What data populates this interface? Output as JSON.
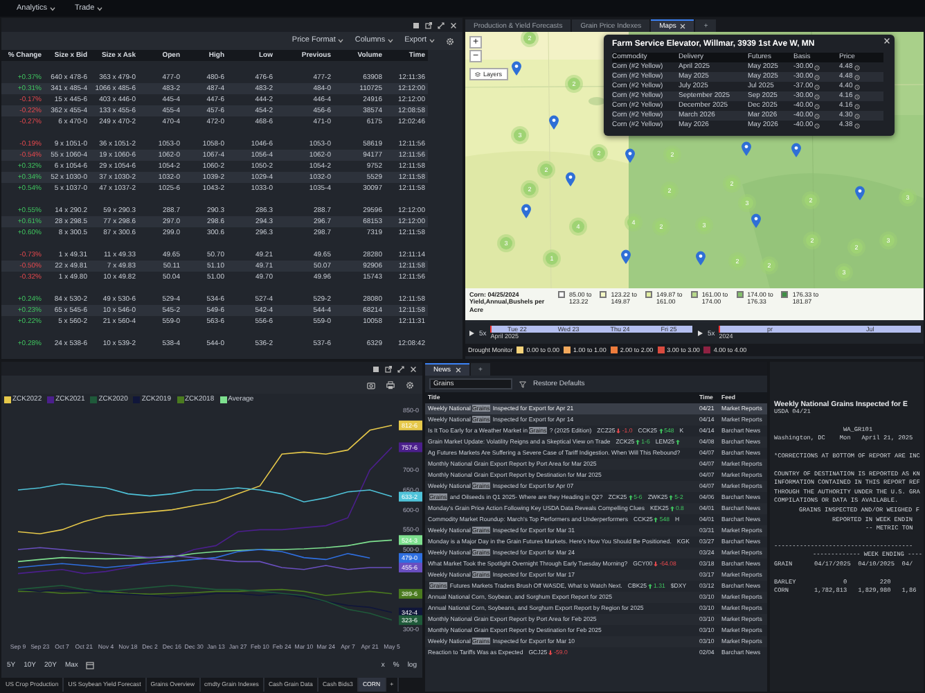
{
  "menu": [
    {
      "label": "Analytics"
    },
    {
      "label": "Trade"
    }
  ],
  "quotes": {
    "toolbar": [
      {
        "label": "Price Format"
      },
      {
        "label": "Columns"
      },
      {
        "label": "Export"
      }
    ],
    "columns": [
      "% Change",
      "Size x Bid",
      "Size x Ask",
      "Open",
      "High",
      "Low",
      "Previous",
      "Volume",
      "Time"
    ],
    "groups": [
      [
        {
          "rising": true,
          "cells": [
            "+0.37%",
            "640 x 478-6",
            "363 x 479-0",
            "477-0",
            "480-6",
            "476-6",
            "477-2",
            "63908",
            "12:11:36"
          ]
        },
        {
          "rising": true,
          "cells": [
            "+0.31%",
            "341 x 485-4",
            "1066 x 485-6",
            "483-2",
            "487-4",
            "483-2",
            "484-0",
            "110725",
            "12:12:00"
          ]
        },
        {
          "rising": false,
          "cells": [
            "-0.17%",
            "15 x 445-6",
            "403 x 446-0",
            "445-4",
            "447-6",
            "444-2",
            "446-4",
            "24916",
            "12:12:00"
          ]
        },
        {
          "rising": false,
          "cells": [
            "-0.22%",
            "362 x 455-4",
            "133 x 455-6",
            "455-4",
            "457-6",
            "454-2",
            "456-6",
            "38574",
            "12:08:58"
          ]
        },
        {
          "rising": false,
          "cells": [
            "-0.27%",
            "6 x 470-0",
            "249 x 470-2",
            "470-4",
            "472-0",
            "468-6",
            "471-0",
            "6175",
            "12:02:46"
          ]
        }
      ],
      [
        {
          "rising": false,
          "cells": [
            "-0.19%",
            "9 x 1051-0",
            "36 x 1051-2",
            "1053-0",
            "1058-0",
            "1046-6",
            "1053-0",
            "58619",
            "12:11:56"
          ]
        },
        {
          "rising": false,
          "cells": [
            "-0.54%",
            "55 x 1060-4",
            "19 x 1060-6",
            "1062-0",
            "1067-4",
            "1056-4",
            "1062-0",
            "94177",
            "12:11:56"
          ]
        },
        {
          "rising": true,
          "cells": [
            "+0.32%",
            "6 x 1054-6",
            "29 x 1054-6",
            "1054-2",
            "1060-2",
            "1050-2",
            "1054-2",
            "9752",
            "12:11:58"
          ]
        },
        {
          "rising": true,
          "cells": [
            "+0.34%",
            "52 x 1030-0",
            "37 x 1030-2",
            "1032-0",
            "1039-2",
            "1029-4",
            "1032-0",
            "5529",
            "12:11:58"
          ]
        },
        {
          "rising": true,
          "cells": [
            "+0.54%",
            "5 x 1037-0",
            "47 x 1037-2",
            "1025-6",
            "1043-2",
            "1033-0",
            "1035-4",
            "30097",
            "12:11:58"
          ]
        }
      ],
      [
        {
          "rising": true,
          "cells": [
            "+0.55%",
            "14 x 290.2",
            "59 x 290.3",
            "288.7",
            "290.3",
            "286.3",
            "288.7",
            "29596",
            "12:12:00"
          ]
        },
        {
          "rising": true,
          "cells": [
            "+0.61%",
            "28 x 298.5",
            "77 x 298.6",
            "297.0",
            "298.6",
            "294.3",
            "296.7",
            "68153",
            "12:12:00"
          ]
        },
        {
          "rising": true,
          "cells": [
            "+0.60%",
            "8 x 300.5",
            "87 x 300.6",
            "299.0",
            "300.6",
            "296.3",
            "298.7",
            "7319",
            "12:11:58"
          ]
        }
      ],
      [
        {
          "rising": false,
          "cells": [
            "-0.73%",
            "1 x 49.31",
            "11 x 49.33",
            "49.65",
            "50.70",
            "49.21",
            "49.65",
            "28280",
            "12:11:14"
          ]
        },
        {
          "rising": false,
          "cells": [
            "-0.50%",
            "22 x 49.81",
            "7 x 49.83",
            "50.11",
            "51.10",
            "49.71",
            "50.07",
            "92906",
            "12:11:58"
          ]
        },
        {
          "rising": false,
          "cells": [
            "-0.32%",
            "1 x 49.80",
            "10 x 49.82",
            "50.04",
            "51.00",
            "49.70",
            "49.96",
            "15743",
            "12:11:56"
          ]
        }
      ],
      [
        {
          "rising": true,
          "cells": [
            "+0.24%",
            "84 x 530-2",
            "49 x 530-6",
            "529-4",
            "534-6",
            "527-4",
            "529-2",
            "28080",
            "12:11:58"
          ]
        },
        {
          "rising": true,
          "cells": [
            "+0.23%",
            "65 x 545-6",
            "10 x 546-0",
            "545-2",
            "549-6",
            "542-4",
            "544-4",
            "68214",
            "12:11:58"
          ]
        },
        {
          "rising": true,
          "cells": [
            "+0.22%",
            "5 x 560-2",
            "21 x 560-4",
            "559-0",
            "563-6",
            "556-6",
            "559-0",
            "10058",
            "12:11:31"
          ]
        }
      ],
      [
        {
          "rising": true,
          "cells": [
            "+0.28%",
            "24 x 538-6",
            "10 x 539-2",
            "538-4",
            "544-0",
            "536-2",
            "537-6",
            "6329",
            "12:08:42"
          ]
        }
      ]
    ]
  },
  "map": {
    "tabs": [
      {
        "label": "Production & Yield Forecasts",
        "selected": false,
        "closable": false
      },
      {
        "label": "Grain Price Indexes",
        "selected": false,
        "closable": false
      },
      {
        "label": "Maps",
        "selected": true,
        "closable": true
      }
    ],
    "add": "+",
    "zoom_in": "+",
    "zoom_out": "−",
    "layers": "Layers",
    "popup": {
      "title": "Farm Service Elevator, Willmar, 3939 1st Ave W, MN",
      "columns": [
        {
          "label": "Commodity",
          "kind": "plain"
        },
        {
          "label": "Delivery",
          "kind": "plain"
        },
        {
          "label": "Futures",
          "kind": "plain"
        },
        {
          "label": "Basis",
          "kind": "timed"
        },
        {
          "label": "Price",
          "kind": "timed"
        }
      ],
      "rows": [
        [
          "Corn (#2 Yellow)",
          "April 2025",
          "May 2025",
          "-30.00",
          "4.48"
        ],
        [
          "Corn (#2 Yellow)",
          "May 2025",
          "May 2025",
          "-30.00",
          "4.48"
        ],
        [
          "Corn (#2 Yellow)",
          "July 2025",
          "Jul 2025",
          "-37.00",
          "4.40"
        ],
        [
          "Corn (#2 Yellow)",
          "September 2025",
          "Sep 2025",
          "-30.00",
          "4.16"
        ],
        [
          "Corn (#2 Yellow)",
          "December 2025",
          "Dec 2025",
          "-40.00",
          "4.16"
        ],
        [
          "Corn (#2 Yellow)",
          "March 2026",
          "Mar 2026",
          "-40.00",
          "4.30"
        ],
        [
          "Corn (#2 Yellow)",
          "May 2026",
          "May 2026",
          "-40.00",
          "4.38"
        ]
      ]
    },
    "clusters": [
      "2",
      "2",
      "3",
      "2",
      "2",
      "2",
      "2",
      "2",
      "2",
      "3",
      "2",
      "3",
      "4",
      "4",
      "2",
      "3",
      "3",
      "2",
      "2",
      "3",
      "1",
      "2",
      "2",
      "3"
    ],
    "legend": {
      "title": "Corn: 04/25/2024",
      "subtitle": "Yield,Annual,Bushels per Acre",
      "bins": [
        {
          "from": "85.00 to",
          "to": "123.22",
          "color": "#ffffff"
        },
        {
          "from": "123.22 to",
          "to": "149.87",
          "color": "#f3f7c4"
        },
        {
          "from": "149.87 to",
          "to": "161.00",
          "color": "#e2eea4"
        },
        {
          "from": "161.00 to",
          "to": "174.00",
          "color": "#b7d88a"
        },
        {
          "from": "174.00 to",
          "to": "176.33",
          "color": "#84c06c"
        },
        {
          "from": "176.33 to",
          "to": "181.87",
          "color": "#3f8f45"
        }
      ]
    },
    "timeline": [
      {
        "speed": "5x",
        "days": [
          "Tue 22",
          "Wed 23",
          "Thu 24",
          "Fri 25"
        ],
        "period": "April 2025"
      },
      {
        "speed": "5x",
        "days": [
          "pr",
          "Jul"
        ],
        "period": "2024"
      }
    ],
    "drought": {
      "label": "Drought Monitor",
      "bins": [
        {
          "label": "0.00 to 0.00",
          "color": "#f5d27a"
        },
        {
          "label": "1.00 to 1.00",
          "color": "#f2a85c"
        },
        {
          "label": "2.00 to 2.00",
          "color": "#ee7c3c"
        },
        {
          "label": "3.00 to 3.00",
          "color": "#d94b3f"
        },
        {
          "label": "4.00 to 4.00",
          "color": "#8e2242"
        }
      ]
    }
  },
  "chart": {
    "legend": [
      {
        "name": "ZCK2022",
        "color": "#e6c84a"
      },
      {
        "name": "ZCK2021",
        "color": "#4b1f8c"
      },
      {
        "name": "ZCK2020",
        "color": "#1f5a3a"
      },
      {
        "name": "ZCK2019",
        "color": "#10163a"
      },
      {
        "name": "ZCK2018",
        "color": "#4a7a1f"
      },
      {
        "name": "Average",
        "color": "#7ee08f"
      }
    ],
    "x_labels": [
      "Sep 9",
      "Sep 23",
      "Oct 7",
      "Oct 21",
      "Nov 4",
      "Nov 18",
      "Dec 2",
      "Dec 16",
      "Dec 30",
      "Jan 13",
      "Jan 27",
      "Feb 10",
      "Feb 24",
      "Mar 10",
      "Mar 24",
      "Apr 7",
      "Apr 21",
      "May 5"
    ],
    "y_labels": [
      "850-0",
      "700-0",
      "650-0",
      "600-0",
      "550-0",
      "500-0",
      "300-0"
    ],
    "price_tags": [
      {
        "text": "812-6",
        "color": "#e6c84a"
      },
      {
        "text": "757-6",
        "color": "#4b1f8c"
      },
      {
        "text": "633-2",
        "color": "#4fc3d9"
      },
      {
        "text": "524-3",
        "color": "#7ee08f"
      },
      {
        "text": "479-0",
        "color": "#2f6fe0"
      },
      {
        "text": "455-6",
        "color": "#6a4fc0"
      },
      {
        "text": "389-6",
        "color": "#4a7a1f"
      },
      {
        "text": "342-4",
        "color": "#10163a"
      },
      {
        "text": "323-6",
        "color": "#1f5a3a"
      }
    ],
    "ranges": [
      "5Y",
      "10Y",
      "20Y",
      "Max"
    ],
    "scales": [
      "x",
      "%",
      "log"
    ]
  },
  "bottom_tabs": [
    {
      "label": "US Crop Production",
      "selected": false
    },
    {
      "label": "US Soybean Yield Forecast",
      "selected": false
    },
    {
      "label": "Grains Overview",
      "selected": false
    },
    {
      "label": "cmdty Grain Indexes",
      "selected": false
    },
    {
      "label": "Cash Grain Data",
      "selected": false
    },
    {
      "label": "Cash Bids3",
      "selected": false
    },
    {
      "label": "CORN",
      "selected": true
    }
  ],
  "bottom_add": "+",
  "news": {
    "tab": {
      "label": "News",
      "selected": true
    },
    "add": "+",
    "search": "Grains",
    "restore": "Restore Defaults",
    "columns": [
      "Title",
      "Time",
      "Feed"
    ],
    "rows": [
      {
        "parts": [
          {
            "kind": "text",
            "text": "Weekly National"
          },
          {
            "kind": "match",
            "text": "Grains"
          },
          {
            "kind": "text",
            "text": "Inspected for Export for Apr 21"
          }
        ],
        "time": "04/21",
        "feed": "Market Reports",
        "selected": true
      },
      {
        "parts": [
          {
            "kind": "text",
            "text": "Weekly National"
          },
          {
            "kind": "match",
            "text": "Grains"
          },
          {
            "kind": "text",
            "text": "Inspected for Export for Apr 14"
          }
        ],
        "time": "04/14",
        "feed": "Market Reports",
        "selected": false
      },
      {
        "parts": [
          {
            "kind": "text",
            "text": "Is It Too Early for a Weather Market in"
          },
          {
            "kind": "match",
            "text": "Grains"
          },
          {
            "kind": "text",
            "text": "? (2025 Edition)"
          },
          {
            "kind": "ticker",
            "symbol": "ZCZ25",
            "rising": false,
            "change": "-1.0"
          },
          {
            "kind": "ticker",
            "symbol": "CCK25",
            "rising": true,
            "change": "548"
          },
          {
            "kind": "ticker",
            "symbol": "K"
          }
        ],
        "time": "04/14",
        "feed": "Barchart News",
        "selected": false
      },
      {
        "parts": [
          {
            "kind": "text",
            "text": "Grain Market Update: Volatility Reigns and a Skeptical View on Trade"
          },
          {
            "kind": "ticker",
            "symbol": "ZCK25",
            "rising": true,
            "change": "1-6"
          },
          {
            "kind": "ticker",
            "symbol": "LEM25",
            "rising": true
          }
        ],
        "time": "04/08",
        "feed": "Barchart News",
        "selected": false
      },
      {
        "parts": [
          {
            "kind": "text",
            "text": "Ag Futures Markets Are Suffering a Severe Case of Tariff Indigestion. When Will This Rebound?"
          }
        ],
        "time": "04/07",
        "feed": "Barchart News",
        "selected": false
      },
      {
        "parts": [
          {
            "kind": "text",
            "text": "Monthly National Grain Export Report by Port Area for Mar 2025"
          }
        ],
        "time": "04/07",
        "feed": "Market Reports",
        "selected": false
      },
      {
        "parts": [
          {
            "kind": "text",
            "text": "Monthly National Grain Export Report by Destination for Mar 2025"
          }
        ],
        "time": "04/07",
        "feed": "Market Reports",
        "selected": false
      },
      {
        "parts": [
          {
            "kind": "text",
            "text": "Weekly National"
          },
          {
            "kind": "match",
            "text": "Grains"
          },
          {
            "kind": "text",
            "text": "Inspected for Export for Apr 07"
          }
        ],
        "time": "04/07",
        "feed": "Market Reports",
        "selected": false
      },
      {
        "parts": [
          {
            "kind": "match",
            "text": "Grains"
          },
          {
            "kind": "text",
            "text": "and Oilseeds in Q1 2025- Where are they Heading in Q2?"
          },
          {
            "kind": "ticker",
            "symbol": "ZCK25",
            "rising": true,
            "change": "5-6"
          },
          {
            "kind": "ticker",
            "symbol": "ZWK25",
            "rising": true,
            "change": "5-2"
          }
        ],
        "time": "04/06",
        "feed": "Barchart News",
        "selected": false
      },
      {
        "parts": [
          {
            "kind": "text",
            "text": "Monday's Grain Price Action Following Key USDA Data Reveals Compelling Clues"
          },
          {
            "kind": "ticker",
            "symbol": "KEK25",
            "rising": true,
            "change": "0.8"
          }
        ],
        "time": "04/01",
        "feed": "Barchart News",
        "selected": false
      },
      {
        "parts": [
          {
            "kind": "text",
            "text": "Commodity Market Roundup: March's Top Performers and Underperformers"
          },
          {
            "kind": "ticker",
            "symbol": "CCK25",
            "rising": true,
            "change": "548"
          },
          {
            "kind": "ticker",
            "symbol": "H"
          }
        ],
        "time": "04/01",
        "feed": "Barchart News",
        "selected": false
      },
      {
        "parts": [
          {
            "kind": "text",
            "text": "Weekly National"
          },
          {
            "kind": "match",
            "text": "Grains"
          },
          {
            "kind": "text",
            "text": "Inspected for Export for Mar 31"
          }
        ],
        "time": "03/31",
        "feed": "Market Reports",
        "selected": false
      },
      {
        "parts": [
          {
            "kind": "text",
            "text": "Monday is a Major Day in the Grain Futures Markets. Here's How You Should Be Positioned."
          },
          {
            "kind": "ticker",
            "symbol": "KGK"
          }
        ],
        "time": "03/27",
        "feed": "Barchart News",
        "selected": false
      },
      {
        "parts": [
          {
            "kind": "text",
            "text": "Weekly National"
          },
          {
            "kind": "match",
            "text": "Grains"
          },
          {
            "kind": "text",
            "text": "Inspected for Export for Mar 24"
          }
        ],
        "time": "03/24",
        "feed": "Market Reports",
        "selected": false
      },
      {
        "parts": [
          {
            "kind": "text",
            "text": "What Market Took the Spotlight Overnight Through Early Tuesday Morning?"
          },
          {
            "kind": "ticker",
            "symbol": "GCY00",
            "rising": false,
            "change": "-64.08"
          }
        ],
        "time": "03/18",
        "feed": "Barchart News",
        "selected": false
      },
      {
        "parts": [
          {
            "kind": "text",
            "text": "Weekly National"
          },
          {
            "kind": "match",
            "text": "Grains"
          },
          {
            "kind": "text",
            "text": "Inspected for Export for Mar 17"
          }
        ],
        "time": "03/17",
        "feed": "Market Reports",
        "selected": false
      },
      {
        "parts": [
          {
            "kind": "match",
            "text": "Grains"
          },
          {
            "kind": "text",
            "text": "Futures Markets Traders Brush Off WASDE, What to Watch Next."
          },
          {
            "kind": "ticker",
            "symbol": "CBK25",
            "rising": true,
            "change": "1.31"
          },
          {
            "kind": "ticker",
            "symbol": "$DXY"
          }
        ],
        "time": "03/12",
        "feed": "Barchart News",
        "selected": false
      },
      {
        "parts": [
          {
            "kind": "text",
            "text": "Annual National Corn, Soybean, and Sorghum Export Report for 2025"
          }
        ],
        "time": "03/10",
        "feed": "Market Reports",
        "selected": false
      },
      {
        "parts": [
          {
            "kind": "text",
            "text": "Annual National Corn, Soybeans, and Sorghum Export Report by Region for 2025"
          }
        ],
        "time": "03/10",
        "feed": "Market Reports",
        "selected": false
      },
      {
        "parts": [
          {
            "kind": "text",
            "text": "Monthly National Grain Export Report by Port Area for Feb 2025"
          }
        ],
        "time": "03/10",
        "feed": "Market Reports",
        "selected": false
      },
      {
        "parts": [
          {
            "kind": "text",
            "text": "Monthly National Grain Export Report by Destination for Feb 2025"
          }
        ],
        "time": "03/10",
        "feed": "Market Reports",
        "selected": false
      },
      {
        "parts": [
          {
            "kind": "text",
            "text": "Weekly National"
          },
          {
            "kind": "match",
            "text": "Grains"
          },
          {
            "kind": "text",
            "text": "Inspected for Export for Mar 10"
          }
        ],
        "time": "03/10",
        "feed": "Market Reports",
        "selected": false
      },
      {
        "parts": [
          {
            "kind": "text",
            "text": "Reaction to Tariffs Was as Expected"
          },
          {
            "kind": "ticker",
            "symbol": "GCJ25",
            "rising": false,
            "change": "-59.0"
          }
        ],
        "time": "02/04",
        "feed": "Barchart News",
        "selected": false
      }
    ]
  },
  "article": {
    "title": "Weekly National Grains Inspected for E",
    "byline": "USDA 04/21",
    "lines": [
      {
        "text": "WA_GR101",
        "kind": "center"
      },
      {
        "text": "Washington, DC    Mon   April 21, 2025",
        "kind": "left"
      },
      {
        "text": "*CORRECTIONS AT BOTTOM OF REPORT ARE INC",
        "kind": "gap"
      },
      {
        "text": "COUNTRY OF DESTINATION IS REPORTED AS KN",
        "kind": "gap"
      },
      {
        "text": "INFORMATION CONTAINED IN THIS REPORT REF",
        "kind": "left"
      },
      {
        "text": "THROUGH THE AUTHORITY UNDER THE U.S. GRA",
        "kind": "left"
      },
      {
        "text": "COMPILATIONS OR DATA IS AVAILABLE.",
        "kind": "left"
      },
      {
        "text": "GRAINS INSPECTED AND/OR WEIGHED F",
        "kind": "indent"
      },
      {
        "text": "REPORTED IN WEEK ENDIN",
        "kind": "indent2"
      },
      {
        "text": "-- METRIC TON",
        "kind": "indent3"
      },
      {
        "text": "--------------------------------------",
        "kind": "gap"
      },
      {
        "text": "------------- WEEK ENDING ----",
        "kind": "indent1"
      },
      {
        "text": "GRAIN      04/17/2025  04/10/2025  04/",
        "kind": "left"
      },
      {
        "text": "BARLEY             0         220",
        "kind": "gap"
      },
      {
        "text": "CORN       1,782,813   1,829,980   1,86",
        "kind": "left"
      }
    ]
  }
}
